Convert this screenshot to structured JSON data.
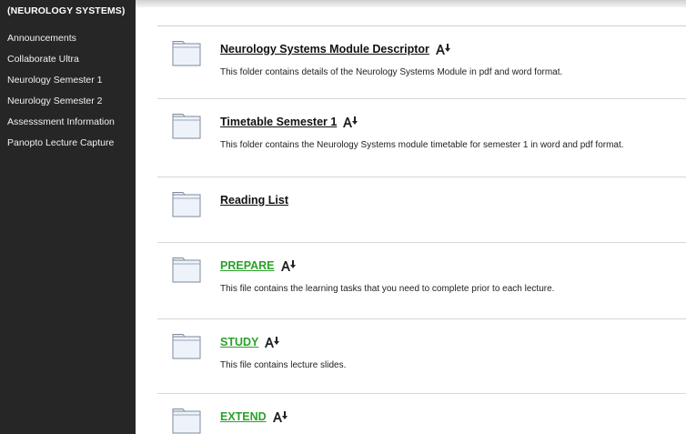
{
  "sidebar": {
    "title": "(NEUROLOGY SYSTEMS)",
    "items": [
      {
        "label": "Announcements"
      },
      {
        "label": "Collaborate Ultra"
      },
      {
        "label": "Neurology Semester 1"
      },
      {
        "label": "Neurology Semester 2"
      },
      {
        "label": "Assesssment Information"
      },
      {
        "label": "Panopto Lecture Capture"
      }
    ]
  },
  "content": {
    "items": [
      {
        "title": "Neurology Systems Module Descriptor",
        "description": "This folder contains details of the Neurology Systems Module in pdf and word format."
      },
      {
        "title": "Timetable Semester 1",
        "description": "This folder contains the Neurology Systems module timetable for semester 1 in word and pdf format."
      },
      {
        "title": "Reading List",
        "description": ""
      },
      {
        "title": "PREPARE",
        "description": "This file contains the learning tasks that you need to complete prior to each lecture."
      },
      {
        "title": "STUDY",
        "description": "This file contains lecture slides."
      },
      {
        "title": "EXTEND",
        "description": ""
      }
    ]
  },
  "colors": {
    "sidebar_bg": "#262626",
    "link_green": "#2aa12a",
    "folder_fill": "#eef3fb",
    "folder_stroke": "#7d8a99"
  },
  "icons": {
    "folder": "folder-icon",
    "ally": "ally-download-icon"
  }
}
